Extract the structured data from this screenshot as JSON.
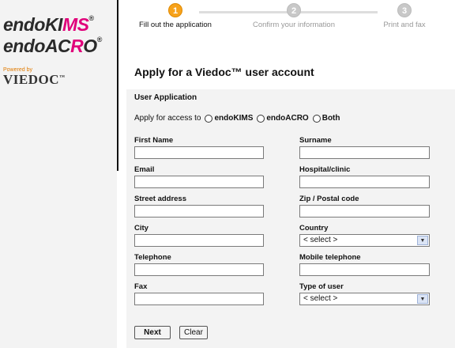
{
  "brand": {
    "logo1_prefix": "endoKI",
    "logo1_highlight": "MS",
    "logo2_prefix": "endoAC",
    "logo2_highlight": "R",
    "logo2_suffix": "O",
    "registered": "®",
    "powered_by": "Powered by",
    "viedoc": "VIEDOC",
    "tm": "™"
  },
  "steps": [
    {
      "number": "1",
      "label": "Fill out the application",
      "active": true
    },
    {
      "number": "2",
      "label": "Confirm your information",
      "active": false
    },
    {
      "number": "3",
      "label": "Print and fax",
      "active": false
    }
  ],
  "page": {
    "title": "Apply for a Viedoc™ user account",
    "section_title": "User Application"
  },
  "access": {
    "prompt": "Apply for access to",
    "options": [
      "endoKIMS",
      "endoACRO",
      "Both"
    ]
  },
  "fields": {
    "first_name": "First Name",
    "surname": "Surname",
    "email": "Email",
    "hospital": "Hospital/clinic",
    "street": "Street address",
    "zip": "Zip / Postal code",
    "city": "City",
    "country": "Country",
    "telephone": "Telephone",
    "mobile": "Mobile telephone",
    "fax": "Fax",
    "type_of_user": "Type of user"
  },
  "selects": {
    "country_value": "< select >",
    "type_value": "< select >"
  },
  "buttons": {
    "next": "Next",
    "clear": "Clear"
  },
  "colors": {
    "accent": "#e0007a",
    "step_active": "#f7a21b",
    "panel_bg": "#f3f3f3"
  }
}
